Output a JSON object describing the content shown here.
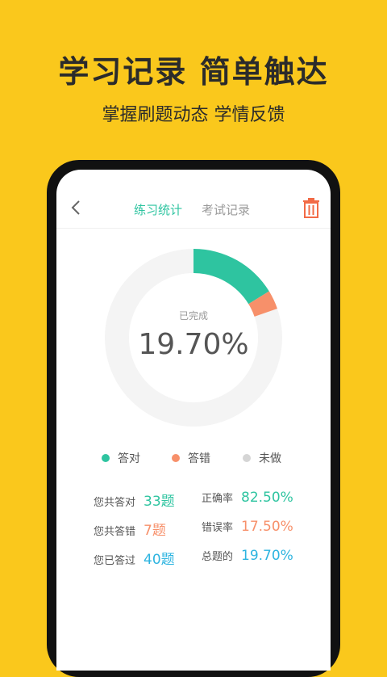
{
  "hero": {
    "title": "学习记录  简单触达",
    "subtitle": "掌握刷题动态 学情反馈"
  },
  "tabs": [
    {
      "label": "练习统计"
    },
    {
      "label": "考试记录"
    }
  ],
  "donut": {
    "label": "已完成",
    "value_text": "19.70%",
    "fractions": {
      "correct": 0.1625,
      "wrong": 0.0345,
      "undone": 0.803
    }
  },
  "legend": [
    {
      "label": "答对",
      "color": "#2EC4A0"
    },
    {
      "label": "答错",
      "color": "#F7906A"
    },
    {
      "label": "未做",
      "color": "#D5D5D5"
    }
  ],
  "stats": {
    "correct_count": {
      "label": "您共答对",
      "value": "33题",
      "color": "#2EC4A0"
    },
    "wrong_count": {
      "label": "您共答错",
      "value": "7题",
      "color": "#F7906A"
    },
    "done_count": {
      "label": "您已答过",
      "value": "40题",
      "color": "#2DB4E0"
    },
    "correct_rate": {
      "label": "正确率",
      "value": "82.50%",
      "color": "#2EC4A0"
    },
    "wrong_rate": {
      "label": "错误率",
      "value": "17.50%",
      "color": "#F7906A"
    },
    "overall_rate": {
      "label": "总题的",
      "value": "19.70%",
      "color": "#2DB4E0"
    }
  },
  "colors": {
    "background": "#FAC81C",
    "accent": "#2EC4A0",
    "trash": "#F26B46"
  }
}
